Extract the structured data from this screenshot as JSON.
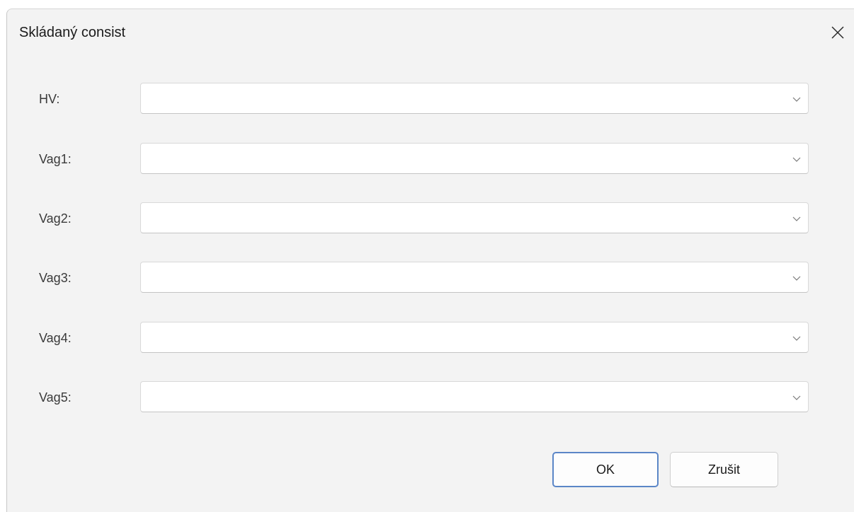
{
  "window": {
    "title": "Skládaný consist"
  },
  "form": {
    "rows": [
      {
        "label": "HV:",
        "value": ""
      },
      {
        "label": "Vag1:",
        "value": ""
      },
      {
        "label": "Vag2:",
        "value": ""
      },
      {
        "label": "Vag3:",
        "value": ""
      },
      {
        "label": "Vag4:",
        "value": ""
      },
      {
        "label": "Vag5:",
        "value": ""
      }
    ]
  },
  "buttons": {
    "ok_label": "OK",
    "cancel_label": "Zrušit"
  },
  "icons": {
    "close": "close-icon",
    "dropdown": "chevron-down-icon"
  },
  "colors": {
    "dialog_background": "#f3f3f3",
    "default_button_border": "#5b86c7"
  }
}
